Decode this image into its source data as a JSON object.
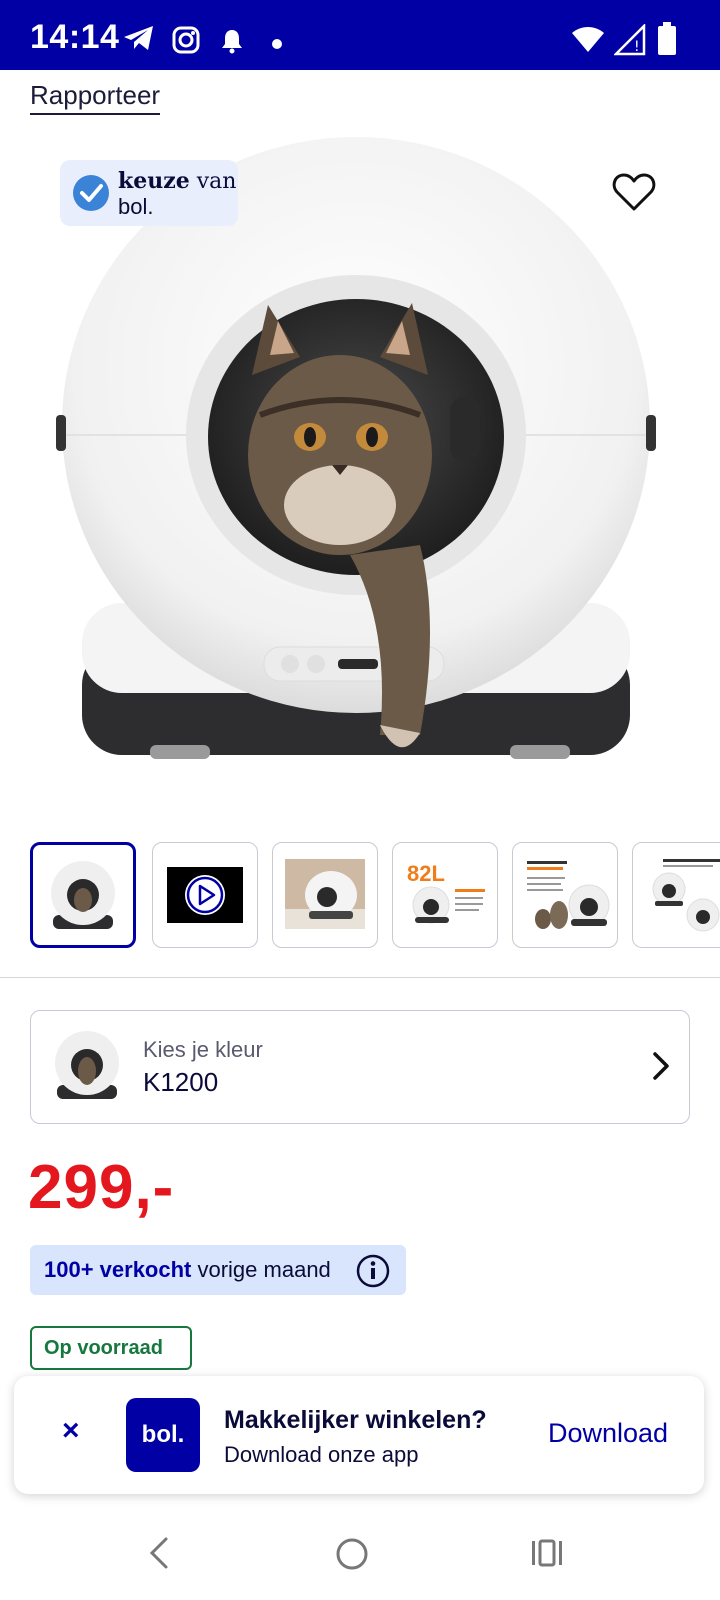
{
  "status_bar": {
    "time": "14:14"
  },
  "product": {
    "report_link": "Rapporteer",
    "badge": {
      "line1_bold": "keuze",
      "line1_rest": " van",
      "line2": "bol."
    },
    "thumbnail_82l": "82L",
    "color_selector": {
      "label": "Kies je kleur",
      "value": "K1200"
    },
    "price": "299,-",
    "sold": {
      "bold": "100+ verkocht",
      "rest": " vorige maand"
    },
    "stock": "Op voorraad"
  },
  "app_banner": {
    "close": "×",
    "logo": "bol.",
    "title": "Makkelijker winkelen?",
    "subtitle": "Download onze app",
    "download": "Download"
  },
  "colors": {
    "brand_blue": "#0000a5",
    "price_red": "#e4171e",
    "stock_green": "#16783e",
    "sold_bg": "#d9e5fd"
  }
}
